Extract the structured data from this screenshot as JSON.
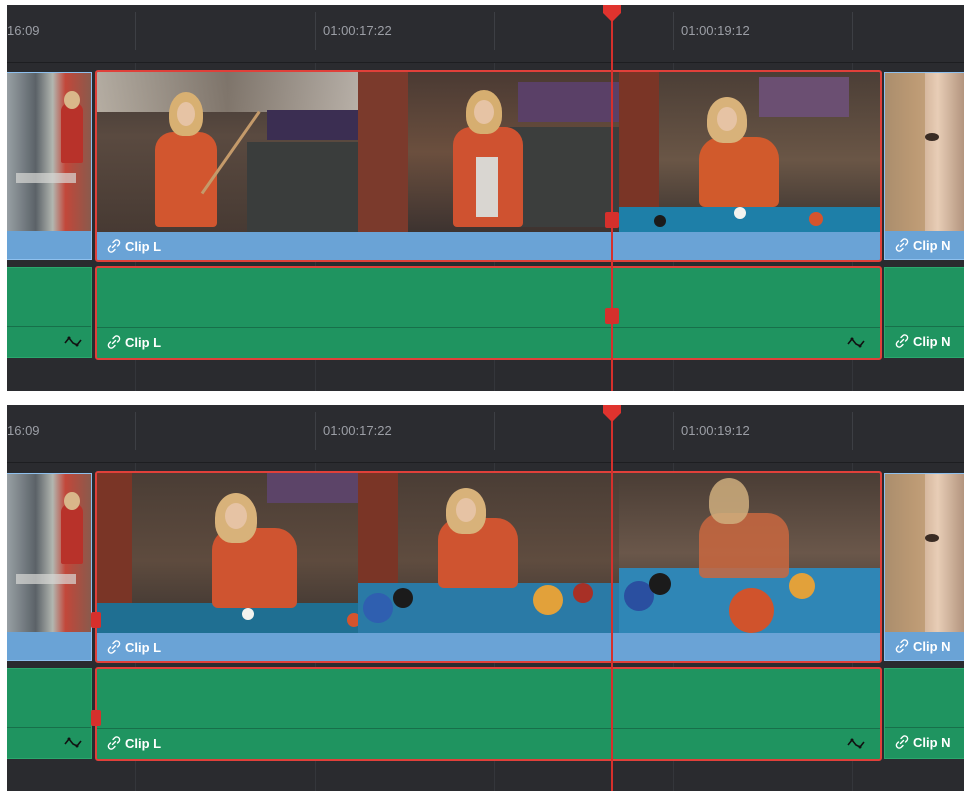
{
  "panels": [
    {
      "timecodes": [
        "16:09",
        "01:00:17:22",
        "01:00:19:12"
      ],
      "video_clip_label": "Clip L",
      "audio_clip_label": "Clip L",
      "next_clip_label": "Clip N"
    },
    {
      "timecodes": [
        "16:09",
        "01:00:17:22",
        "01:00:19:12"
      ],
      "video_clip_label": "Clip L",
      "audio_clip_label": "Clip L",
      "next_clip_label": "Clip N"
    }
  ],
  "colors": {
    "video_clip": "#6aa3d6",
    "audio_clip": "#1f9460",
    "selection": "#e0403a",
    "playhead": "#d5302c",
    "background": "#2a2b2f"
  },
  "icons": [
    "link-icon",
    "waveform-keyframe-icon",
    "playhead-marker-icon"
  ]
}
